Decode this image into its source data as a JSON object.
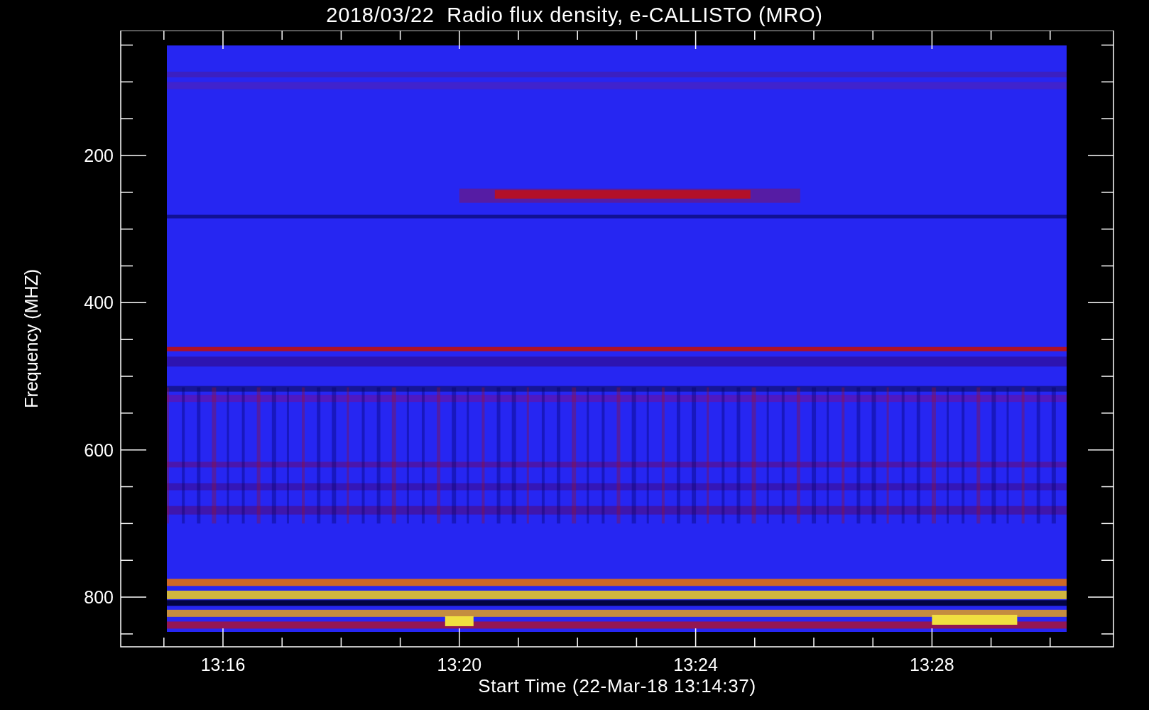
{
  "title": "2018/03/22  Radio flux density, e-CALLISTO (MRO)",
  "y_axis": {
    "label": "Frequency (MHZ)",
    "ticks": [
      "200",
      "400",
      "600",
      "800"
    ]
  },
  "x_axis": {
    "label": "Start Time (22-Mar-18 13:14:37)",
    "ticks": [
      "13:16",
      "13:20",
      "13:24",
      "13:28"
    ]
  }
}
